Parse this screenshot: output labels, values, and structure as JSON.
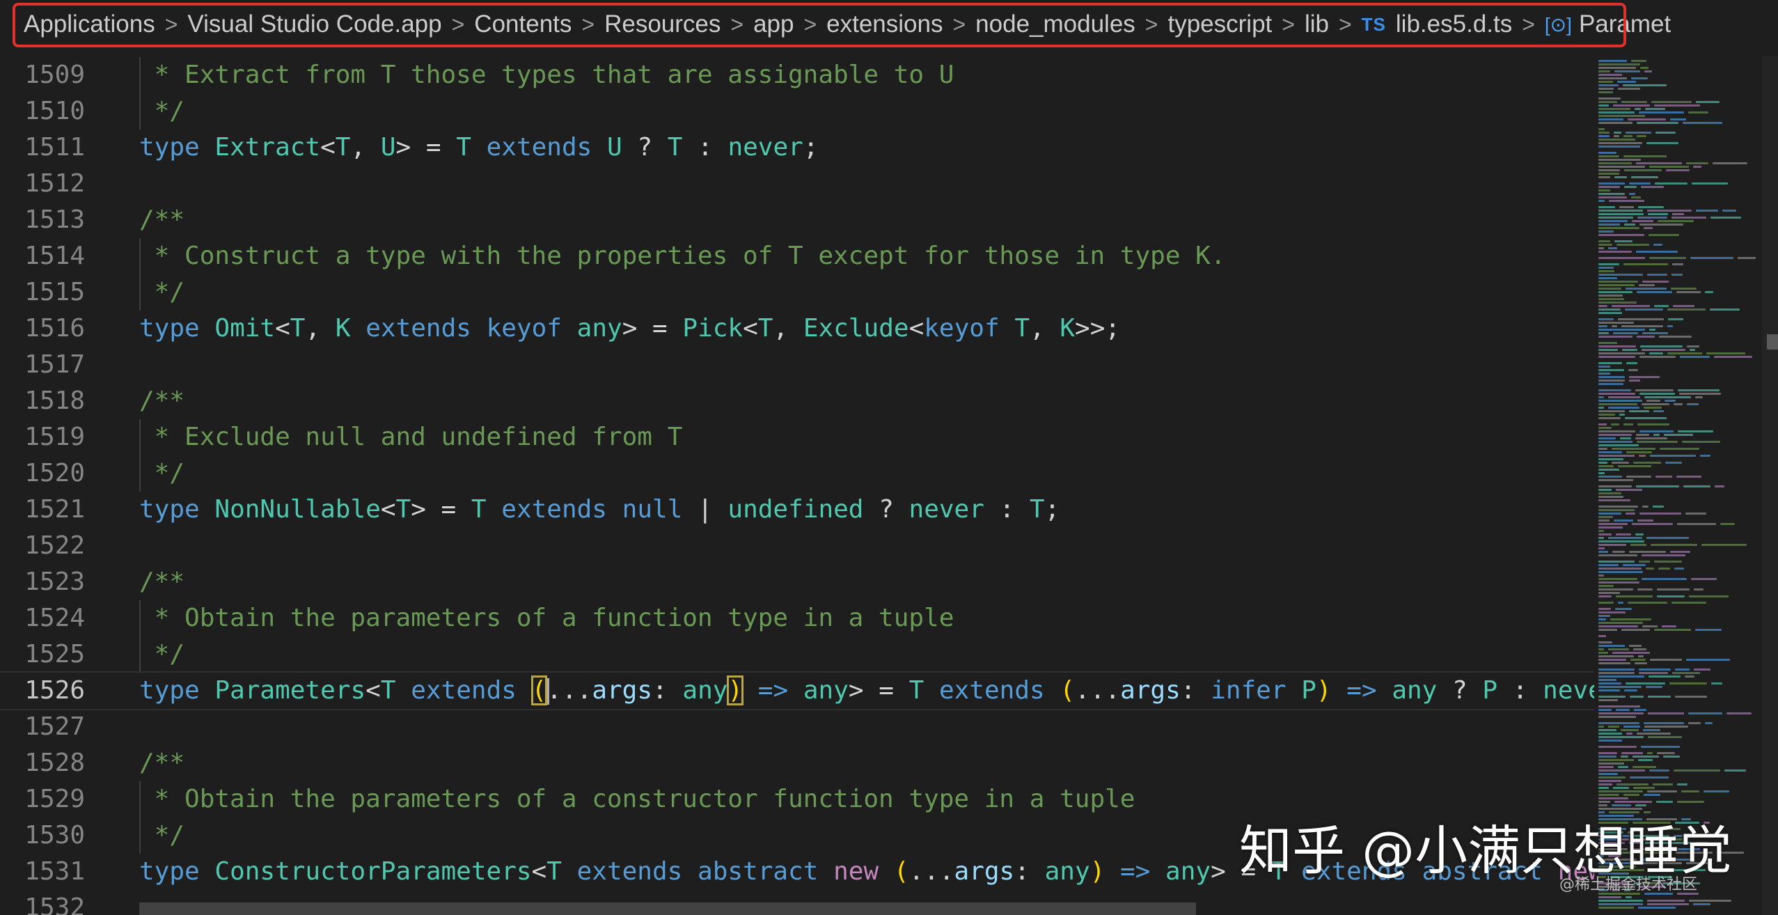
{
  "breadcrumb": {
    "items": [
      {
        "label": "Applications"
      },
      {
        "label": "Visual Studio Code.app"
      },
      {
        "label": "Contents"
      },
      {
        "label": "Resources"
      },
      {
        "label": "app"
      },
      {
        "label": "extensions"
      },
      {
        "label": "node_modules"
      },
      {
        "label": "typescript"
      },
      {
        "label": "lib"
      },
      {
        "label": "lib.es5.d.ts",
        "badge": "TS"
      },
      {
        "label": "Paramet",
        "icon": "[⊙]"
      }
    ],
    "separator": ">",
    "highlight_color": "#e0312a"
  },
  "editor": {
    "language": "typescript",
    "current_line": 1526,
    "lines": [
      {
        "n": "1509",
        "tokens": [
          [
            " * Extract from T those types that are assignable to U",
            "cm"
          ]
        ]
      },
      {
        "n": "1510",
        "tokens": [
          [
            " */",
            "cm"
          ]
        ]
      },
      {
        "n": "1511",
        "tokens": [
          [
            "type",
            "kw"
          ],
          [
            " ",
            "pu"
          ],
          [
            "Extract",
            "ty"
          ],
          [
            "<",
            "pu"
          ],
          [
            "T",
            "ty"
          ],
          [
            ", ",
            "pu"
          ],
          [
            "U",
            "ty"
          ],
          [
            "> = ",
            "pu"
          ],
          [
            "T",
            "ty"
          ],
          [
            " ",
            "pu"
          ],
          [
            "extends",
            "kw"
          ],
          [
            " ",
            "pu"
          ],
          [
            "U",
            "ty"
          ],
          [
            " ? ",
            "pu"
          ],
          [
            "T",
            "ty"
          ],
          [
            " : ",
            "pu"
          ],
          [
            "never",
            "ty"
          ],
          [
            ";",
            "pu"
          ]
        ]
      },
      {
        "n": "1512",
        "tokens": []
      },
      {
        "n": "1513",
        "tokens": [
          [
            "/**",
            "cm"
          ]
        ]
      },
      {
        "n": "1514",
        "tokens": [
          [
            " * Construct a type with the properties of T except for those in type K.",
            "cm"
          ]
        ]
      },
      {
        "n": "1515",
        "tokens": [
          [
            " */",
            "cm"
          ]
        ]
      },
      {
        "n": "1516",
        "tokens": [
          [
            "type",
            "kw"
          ],
          [
            " ",
            "pu"
          ],
          [
            "Omit",
            "ty"
          ],
          [
            "<",
            "pu"
          ],
          [
            "T",
            "ty"
          ],
          [
            ", ",
            "pu"
          ],
          [
            "K",
            "ty"
          ],
          [
            " ",
            "pu"
          ],
          [
            "extends",
            "kw"
          ],
          [
            " ",
            "pu"
          ],
          [
            "keyof",
            "kw"
          ],
          [
            " ",
            "pu"
          ],
          [
            "any",
            "ty"
          ],
          [
            "> = ",
            "pu"
          ],
          [
            "Pick",
            "ty"
          ],
          [
            "<",
            "pu"
          ],
          [
            "T",
            "ty"
          ],
          [
            ", ",
            "pu"
          ],
          [
            "Exclude",
            "ty"
          ],
          [
            "<",
            "pu"
          ],
          [
            "keyof",
            "kw"
          ],
          [
            " ",
            "pu"
          ],
          [
            "T",
            "ty"
          ],
          [
            ", ",
            "pu"
          ],
          [
            "K",
            "ty"
          ],
          [
            ">>;",
            "pu"
          ]
        ]
      },
      {
        "n": "1517",
        "tokens": []
      },
      {
        "n": "1518",
        "tokens": [
          [
            "/**",
            "cm"
          ]
        ]
      },
      {
        "n": "1519",
        "tokens": [
          [
            " * Exclude null and undefined from T",
            "cm"
          ]
        ]
      },
      {
        "n": "1520",
        "tokens": [
          [
            " */",
            "cm"
          ]
        ]
      },
      {
        "n": "1521",
        "tokens": [
          [
            "type",
            "kw"
          ],
          [
            " ",
            "pu"
          ],
          [
            "NonNullable",
            "ty"
          ],
          [
            "<",
            "pu"
          ],
          [
            "T",
            "ty"
          ],
          [
            "> = ",
            "pu"
          ],
          [
            "T",
            "ty"
          ],
          [
            " ",
            "pu"
          ],
          [
            "extends",
            "kw"
          ],
          [
            " ",
            "pu"
          ],
          [
            "null",
            "kw"
          ],
          [
            " | ",
            "pu"
          ],
          [
            "undefined",
            "ty"
          ],
          [
            " ? ",
            "pu"
          ],
          [
            "never",
            "ty"
          ],
          [
            " : ",
            "pu"
          ],
          [
            "T",
            "ty"
          ],
          [
            ";",
            "pu"
          ]
        ]
      },
      {
        "n": "1522",
        "tokens": []
      },
      {
        "n": "1523",
        "tokens": [
          [
            "/**",
            "cm"
          ]
        ]
      },
      {
        "n": "1524",
        "tokens": [
          [
            " * Obtain the parameters of a function type in a tuple",
            "cm"
          ]
        ]
      },
      {
        "n": "1525",
        "tokens": [
          [
            " */",
            "cm"
          ]
        ]
      },
      {
        "n": "1526",
        "tokens": [
          [
            "type",
            "kw"
          ],
          [
            " ",
            "pu"
          ],
          [
            "Parameters",
            "ty"
          ],
          [
            "<",
            "pu"
          ],
          [
            "T",
            "ty"
          ],
          [
            " ",
            "pu"
          ],
          [
            "extends",
            "kw"
          ],
          [
            " ",
            "pu"
          ],
          [
            "(",
            "br bm"
          ],
          [
            "|",
            "cursor"
          ],
          [
            "...",
            "pu"
          ],
          [
            "args",
            "pr"
          ],
          [
            ": ",
            "pu"
          ],
          [
            "any",
            "ty"
          ],
          [
            ")",
            "br bm"
          ],
          [
            " ",
            "pu"
          ],
          [
            "=>",
            "kw"
          ],
          [
            " ",
            "pu"
          ],
          [
            "any",
            "ty"
          ],
          [
            "> = ",
            "pu"
          ],
          [
            "T",
            "ty"
          ],
          [
            " ",
            "pu"
          ],
          [
            "extends",
            "kw"
          ],
          [
            " ",
            "pu"
          ],
          [
            "(",
            "br"
          ],
          [
            "...",
            "pu"
          ],
          [
            "args",
            "pr"
          ],
          [
            ": ",
            "pu"
          ],
          [
            "infer",
            "kw"
          ],
          [
            " ",
            "pu"
          ],
          [
            "P",
            "ty"
          ],
          [
            ")",
            "br"
          ],
          [
            " ",
            "pu"
          ],
          [
            "=>",
            "kw"
          ],
          [
            " ",
            "pu"
          ],
          [
            "any",
            "ty"
          ],
          [
            " ? ",
            "pu"
          ],
          [
            "P",
            "ty"
          ],
          [
            " : ",
            "pu"
          ],
          [
            "never",
            "ty"
          ],
          [
            ";",
            "pu"
          ]
        ]
      },
      {
        "n": "1527",
        "tokens": []
      },
      {
        "n": "1528",
        "tokens": [
          [
            "/**",
            "cm"
          ]
        ]
      },
      {
        "n": "1529",
        "tokens": [
          [
            " * Obtain the parameters of a constructor function type in a tuple",
            "cm"
          ]
        ]
      },
      {
        "n": "1530",
        "tokens": [
          [
            " */",
            "cm"
          ]
        ]
      },
      {
        "n": "1531",
        "tokens": [
          [
            "type",
            "kw"
          ],
          [
            " ",
            "pu"
          ],
          [
            "ConstructorParameters",
            "ty"
          ],
          [
            "<",
            "pu"
          ],
          [
            "T",
            "ty"
          ],
          [
            " ",
            "pu"
          ],
          [
            "extends",
            "kw"
          ],
          [
            " ",
            "pu"
          ],
          [
            "abstract",
            "kw"
          ],
          [
            " ",
            "pu"
          ],
          [
            "new",
            "ctl"
          ],
          [
            " ",
            "pu"
          ],
          [
            "(",
            "br"
          ],
          [
            "...",
            "pu"
          ],
          [
            "args",
            "pr"
          ],
          [
            ": ",
            "pu"
          ],
          [
            "any",
            "ty"
          ],
          [
            ")",
            "br"
          ],
          [
            " ",
            "pu"
          ],
          [
            "=>",
            "kw"
          ],
          [
            " ",
            "pu"
          ],
          [
            "any",
            "ty"
          ],
          [
            "> = ",
            "pu"
          ],
          [
            "T",
            "ty"
          ],
          [
            " ",
            "pu"
          ],
          [
            "extends",
            "kw"
          ],
          [
            " ",
            "pu"
          ],
          [
            "abstract",
            "kw"
          ],
          [
            " ",
            "pu"
          ],
          [
            "new",
            "ctl"
          ],
          [
            " ",
            "pu"
          ],
          [
            "(",
            "br"
          ],
          [
            "...",
            "pu"
          ]
        ]
      },
      {
        "n": "1532",
        "tokens": []
      }
    ]
  },
  "watermark": {
    "main": "知乎 @小满只想睡觉",
    "sub": "@稀土掘金技术社区"
  },
  "colors": {
    "keyword": "#569cd6",
    "type": "#4ec9b0",
    "comment": "#6a9955",
    "param": "#9cdcfe",
    "control": "#c586c0",
    "bracket": "#ffd700",
    "background": "#1e1e1e"
  }
}
